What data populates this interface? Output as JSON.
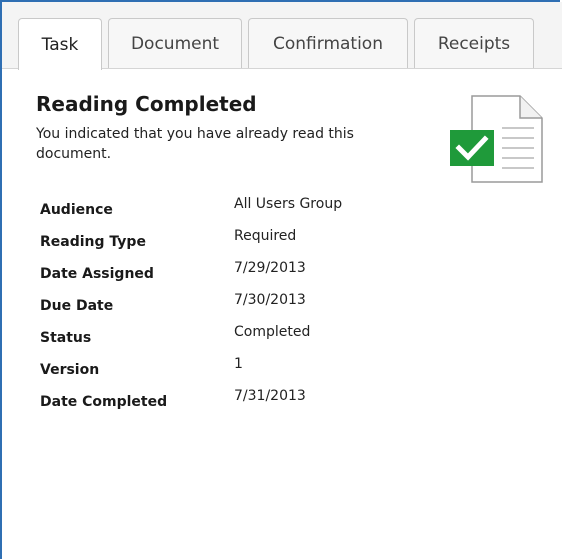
{
  "tabs": [
    {
      "label": "Task",
      "active": true
    },
    {
      "label": "Document",
      "active": false
    },
    {
      "label": "Confirmation",
      "active": false
    },
    {
      "label": "Receipts",
      "active": false
    }
  ],
  "status": {
    "title": "Reading Completed",
    "description": "You indicated that you have already read this document.",
    "icon": "document-check-icon",
    "check_color": "#1f9a3a"
  },
  "details": [
    {
      "label": "Audience",
      "value": "All Users Group"
    },
    {
      "label": "Reading Type",
      "value": "Required"
    },
    {
      "label": "Date Assigned",
      "value": "7/29/2013"
    },
    {
      "label": "Due Date",
      "value": "7/30/2013"
    },
    {
      "label": "Status",
      "value": "Completed"
    },
    {
      "label": "Version",
      "value": "1"
    },
    {
      "label": "Date Completed",
      "value": "7/31/2013"
    }
  ],
  "colors": {
    "frame_border": "#2f6fb3",
    "tab_border": "#c9c9c9"
  }
}
